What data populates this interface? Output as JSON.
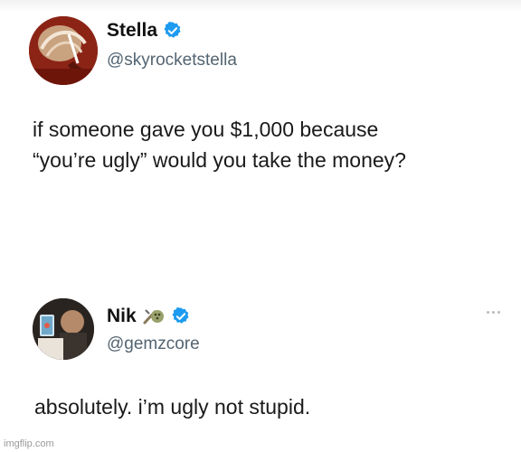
{
  "main_tweet": {
    "display_name": "Stella",
    "handle": "@skyrocketstella",
    "text": "if someone gave you $1,000 because\n“you’re ugly” would you take the money?",
    "verified": true,
    "avatar": "profile-photo-red"
  },
  "reply_tweet": {
    "display_name": "Nik",
    "handle": "@gemzcore",
    "text": "absolutely. i’m ugly not stupid.",
    "verified": true,
    "name_emoji": "bowling-emoji-icon",
    "avatar": "profile-photo-dark",
    "more_icon": "more-options-icon"
  },
  "watermark": "imgflip.com",
  "colors": {
    "verified_blue": "#1d9bf0",
    "handle_gray": "#536471",
    "text": "#0f1419"
  }
}
